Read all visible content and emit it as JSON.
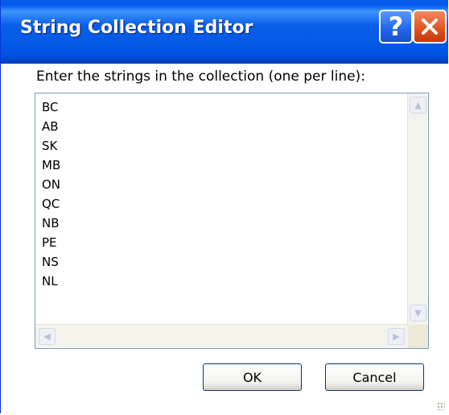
{
  "window": {
    "title": "String Collection Editor",
    "help_label": "?",
    "close_label": "✕"
  },
  "editor": {
    "prompt": "Enter the strings in the collection (one per line):",
    "lines": [
      "BC",
      "AB",
      "SK",
      "MB",
      "ON",
      "QC",
      "NB",
      "PE",
      "NS",
      "NL"
    ]
  },
  "buttons": {
    "ok": "OK",
    "cancel": "Cancel"
  },
  "colors": {
    "titlebar": "#0a5fe8",
    "close_button": "#e0511e",
    "window_frame": "#ece9d8"
  }
}
